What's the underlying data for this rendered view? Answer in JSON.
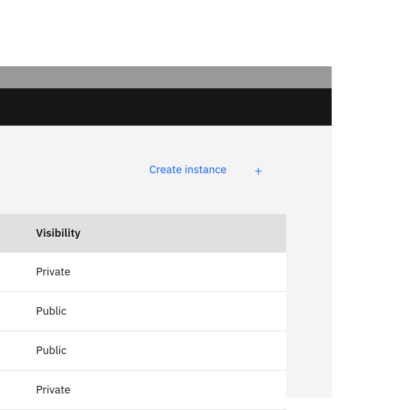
{
  "actions": {
    "create_label": "Create instance"
  },
  "table": {
    "header": "Visibility",
    "rows": [
      {
        "value": "Private"
      },
      {
        "value": "Public"
      },
      {
        "value": "Public"
      },
      {
        "value": "Private"
      }
    ]
  }
}
